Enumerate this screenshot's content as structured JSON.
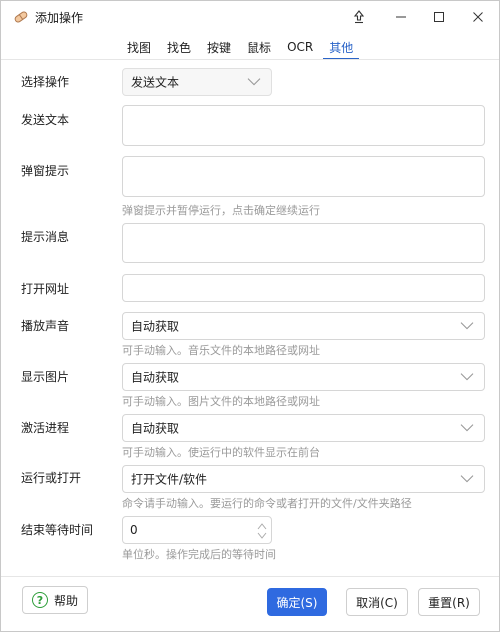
{
  "window": {
    "title": "添加操作",
    "icons": {
      "app": "app-icon",
      "pin": "pin-icon",
      "minimize": "minimize-icon",
      "maximize": "maximize-icon",
      "close": "close-icon"
    }
  },
  "tabs": [
    {
      "label": "找图",
      "active": false
    },
    {
      "label": "找色",
      "active": false
    },
    {
      "label": "按键",
      "active": false
    },
    {
      "label": "鼠标",
      "active": false
    },
    {
      "label": "OCR",
      "active": false
    },
    {
      "label": "其他",
      "active": true
    }
  ],
  "form": {
    "select_action": {
      "label": "选择操作",
      "value": "发送文本"
    },
    "send_text": {
      "label": "发送文本",
      "value": ""
    },
    "popup_tip": {
      "label": "弹窗提示",
      "value": "",
      "hint": "弹窗提示并暂停运行，点击确定继续运行"
    },
    "tip_message": {
      "label": "提示消息",
      "value": ""
    },
    "open_url": {
      "label": "打开网址",
      "value": ""
    },
    "play_sound": {
      "label": "播放声音",
      "value": "自动获取",
      "hint": "可手动输入。音乐文件的本地路径或网址"
    },
    "show_image": {
      "label": "显示图片",
      "value": "自动获取",
      "hint": "可手动输入。图片文件的本地路径或网址"
    },
    "activate_process": {
      "label": "激活进程",
      "value": "自动获取",
      "hint": "可手动输入。使运行中的软件显示在前台"
    },
    "run_or_open": {
      "label": "运行或打开",
      "value": "打开文件/软件",
      "hint": "命令请手动输入。要运行的命令或者打开的文件/文件夹路径"
    },
    "end_wait": {
      "label": "结束等待时间",
      "value": "0",
      "hint": "单位秒。操作完成后的等待时间"
    }
  },
  "footer": {
    "help": "帮助",
    "ok": "确定(S)",
    "cancel": "取消(C)",
    "reset": "重置(R)"
  },
  "colors": {
    "accent": "#2f6ae0",
    "help_green": "#2e9e3a",
    "hint": "#9a9a9a",
    "border": "#d6d6d6"
  }
}
